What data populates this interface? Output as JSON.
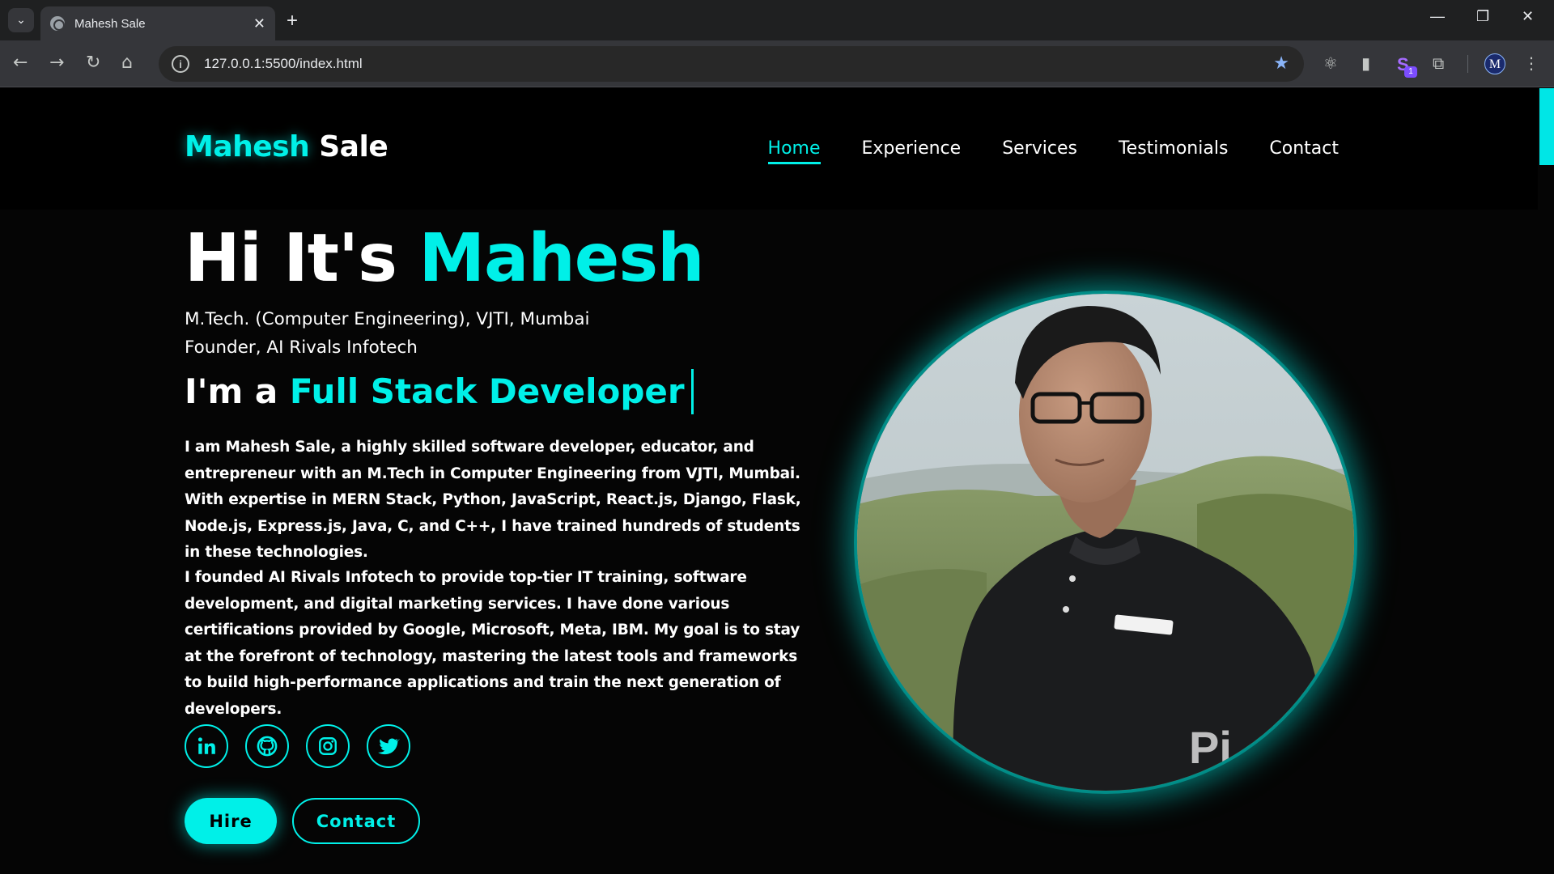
{
  "browser": {
    "tab_title": "Mahesh Sale",
    "url": "127.0.0.1:5500/index.html",
    "extension_badge": "1",
    "profile_initial": "M"
  },
  "site": {
    "logo_first": "Mahesh",
    "logo_last": " Sale",
    "nav": [
      {
        "label": "Home",
        "active": true
      },
      {
        "label": "Experience"
      },
      {
        "label": "Services"
      },
      {
        "label": "Testimonials"
      },
      {
        "label": "Contact"
      }
    ]
  },
  "hero": {
    "greeting": "Hi It's ",
    "name": "Mahesh",
    "subtitle_1": "M.Tech. (Computer Engineering), VJTI, Mumbai",
    "subtitle_2": "Founder, AI Rivals Infotech",
    "role_prefix": "I'm a ",
    "role": "Full Stack Developer",
    "para_1": "I am Mahesh Sale, a highly skilled software developer, educator, and entrepreneur with an M.Tech in Computer Engineering from VJTI, Mumbai. With expertise in MERN Stack, Python, JavaScript, React.js, Django, Flask, Node.js, Express.js, Java, C, and C++, I have trained hundreds of students in these technologies.",
    "para_2": "I founded AI Rivals Infotech to provide top-tier IT training, software development, and digital marketing services. I have done various certifications provided by Google, Microsoft, Meta, IBM. My goal is to stay at the forefront of technology, mastering the latest tools and frameworks to build high-performance applications and train the next generation of developers.",
    "socials": [
      "linkedin-icon",
      "github-icon",
      "instagram-icon",
      "twitter-icon"
    ],
    "hire_label": "Hire",
    "contact_label": "Contact"
  },
  "colors": {
    "accent": "#00f0e8",
    "background": "#050505"
  }
}
